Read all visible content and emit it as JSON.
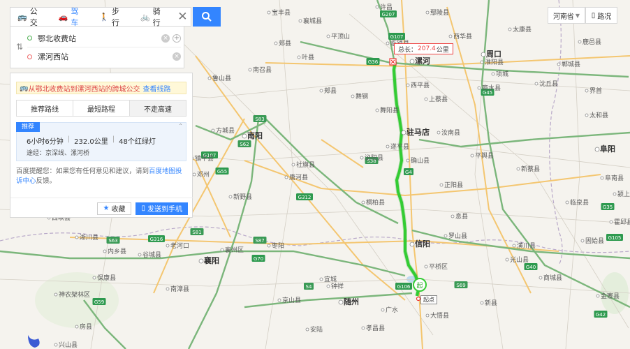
{
  "modes": [
    {
      "label": "公交",
      "icon": "bus-icon"
    },
    {
      "label": "驾车",
      "icon": "car-icon"
    },
    {
      "label": "步行",
      "icon": "walk-icon"
    },
    {
      "label": "骑行",
      "icon": "bike-icon"
    }
  ],
  "route": {
    "start": "鄂北收费站",
    "end": "漯河西站"
  },
  "transit_tip": {
    "text": "从鄂北收费站到漯河西站的跨城公交",
    "link": "查看线路"
  },
  "route_tabs": [
    "推荐路线",
    "最短路程",
    "不走高速"
  ],
  "recommend": {
    "badge": "推荐",
    "time": "6小时6分钟",
    "distance": "232.0公里",
    "lights": "48个红绿灯",
    "via": "途经：京深线、漯河桥"
  },
  "feedback": {
    "prefix": "百度提醒您：如果您有任何意见和建议，请到",
    "link": "百度地图投诉中心",
    "suffix": "反馈。"
  },
  "actions": {
    "fav": "收藏",
    "send": "发送到手机"
  },
  "region": "河南省",
  "road_condition": "路况",
  "distance_popup": {
    "prefix": "总长：",
    "value": "207.4",
    "unit": "公里"
  },
  "start_label": "起点",
  "start_marker": "起",
  "colors": {
    "accent": "#3385ff",
    "route": "#33cc33",
    "highway": "#5aa05a",
    "national_road": "#f0c060"
  },
  "cities": [
    {
      "name": "许昌",
      "major": false
    },
    {
      "name": "平顶山",
      "major": false
    },
    {
      "name": "漯河",
      "major": true
    },
    {
      "name": "周口",
      "major": true
    },
    {
      "name": "驻马店",
      "major": true
    },
    {
      "name": "南阳",
      "major": true
    },
    {
      "name": "信阳",
      "major": true
    },
    {
      "name": "襄阳",
      "major": true
    },
    {
      "name": "随州",
      "major": true
    },
    {
      "name": "阜阳",
      "major": true
    },
    {
      "name": "西平县",
      "major": false
    },
    {
      "name": "上蔡县",
      "major": false
    },
    {
      "name": "汝南县",
      "major": false
    },
    {
      "name": "确山县",
      "major": false
    },
    {
      "name": "正阳县",
      "major": false
    },
    {
      "name": "舞钢",
      "major": false
    },
    {
      "name": "泌阳县",
      "major": false
    },
    {
      "name": "唐河县",
      "major": false
    },
    {
      "name": "社旗县",
      "major": false
    },
    {
      "name": "方城县",
      "major": false
    },
    {
      "name": "新野县",
      "major": false
    },
    {
      "name": "邓州",
      "major": false
    },
    {
      "name": "镇平县",
      "major": false
    },
    {
      "name": "南召县",
      "major": false
    },
    {
      "name": "桐柏县",
      "major": false
    },
    {
      "name": "罗山县",
      "major": false
    },
    {
      "name": "光山县",
      "major": false
    },
    {
      "name": "潢川县",
      "major": false
    },
    {
      "name": "息县",
      "major": false
    },
    {
      "name": "平舆县",
      "major": false
    },
    {
      "name": "新蔡县",
      "major": false
    },
    {
      "name": "项城",
      "major": false
    },
    {
      "name": "沈丘县",
      "major": false
    },
    {
      "name": "郸城县",
      "major": false
    },
    {
      "name": "商水县",
      "major": false
    },
    {
      "name": "西华县",
      "major": false
    },
    {
      "name": "淮阳县",
      "major": false
    },
    {
      "name": "枣阳",
      "major": false
    },
    {
      "name": "宜城",
      "major": false
    },
    {
      "name": "老河口",
      "major": false
    },
    {
      "name": "谷城县",
      "major": false
    },
    {
      "name": "保康县",
      "major": false
    },
    {
      "name": "南漳县",
      "major": false
    },
    {
      "name": "钟祥",
      "major": false
    },
    {
      "name": "京山县",
      "major": false
    },
    {
      "name": "广水",
      "major": false
    },
    {
      "name": "大悟县",
      "major": false
    },
    {
      "name": "孝昌县",
      "major": false
    },
    {
      "name": "安陆",
      "major": false
    },
    {
      "name": "神农架林区",
      "major": false
    },
    {
      "name": "兴山县",
      "major": false
    },
    {
      "name": "房县",
      "major": false
    },
    {
      "name": "内乡县",
      "major": false
    },
    {
      "name": "淅川县",
      "major": false
    },
    {
      "name": "宝丰县",
      "major": false
    },
    {
      "name": "叶县",
      "major": false
    },
    {
      "name": "襄城县",
      "major": false
    },
    {
      "name": "郏县",
      "major": false
    },
    {
      "name": "临颍县",
      "major": false
    },
    {
      "name": "鄢陵县",
      "major": false
    },
    {
      "name": "太康县",
      "major": false
    },
    {
      "name": "鹿邑县",
      "major": false
    },
    {
      "name": "界首",
      "major": false
    },
    {
      "name": "太和县",
      "major": false
    },
    {
      "name": "阜南县",
      "major": false
    },
    {
      "name": "临泉县",
      "major": false
    },
    {
      "name": "固始县",
      "major": false
    },
    {
      "name": "商城县",
      "major": false
    },
    {
      "name": "新县",
      "major": false
    },
    {
      "name": "平桥区",
      "major": false
    },
    {
      "name": "金寨县",
      "major": false
    },
    {
      "name": "霍邱县",
      "major": false
    },
    {
      "name": "颍上县",
      "major": false
    },
    {
      "name": "西峡县",
      "major": false
    },
    {
      "name": "鲁山县",
      "major": false
    },
    {
      "name": "郏县",
      "major": false
    },
    {
      "name": "舞阳县",
      "major": false
    },
    {
      "name": "遂平县",
      "major": false
    },
    {
      "name": "襄州区",
      "major": false
    }
  ],
  "highways": [
    "G36",
    "G107",
    "G4",
    "S38",
    "S83",
    "G55",
    "G207",
    "G40",
    "G45",
    "G70",
    "G312",
    "G316",
    "G35",
    "G105",
    "S63",
    "G59",
    "G42",
    "S4",
    "S62",
    "G107",
    "S81",
    "S87",
    "G106",
    "S69"
  ]
}
